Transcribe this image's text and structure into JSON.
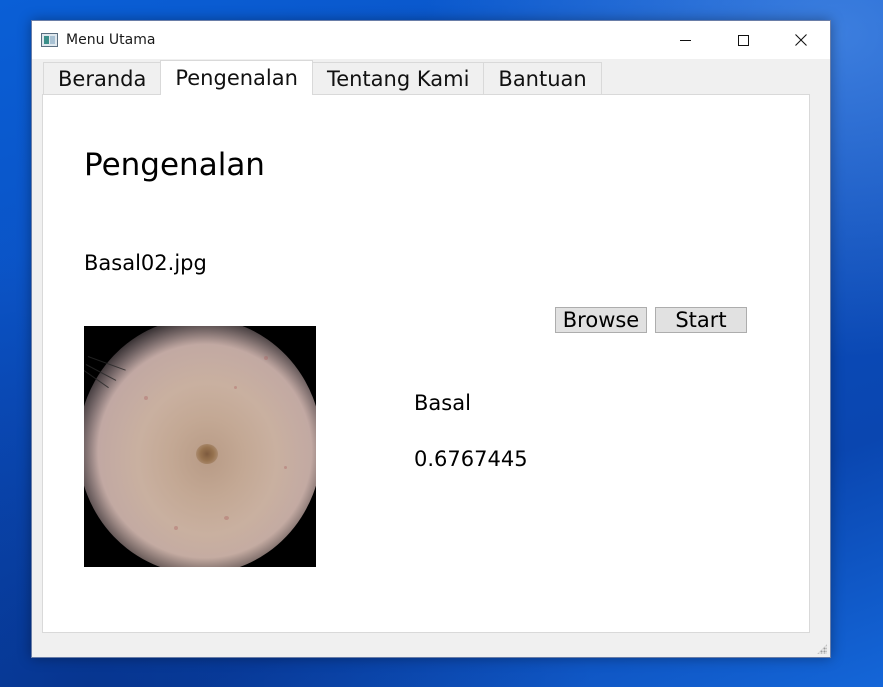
{
  "window": {
    "title": "Menu Utama",
    "icon": "app-window-icon",
    "controls": [
      "minimize-icon",
      "maximize-icon",
      "close-icon"
    ]
  },
  "tabs": [
    {
      "label": "Beranda",
      "active": false
    },
    {
      "label": "Pengenalan",
      "active": true
    },
    {
      "label": "Tentang Kami",
      "active": false
    },
    {
      "label": "Bantuan",
      "active": false
    }
  ],
  "page": {
    "title": "Pengenalan",
    "file_name": "Basal02.jpg",
    "browse_label": "Browse",
    "start_label": "Start",
    "result_class": "Basal",
    "result_score": "0.6767445"
  },
  "colors": {
    "desktop": "#0b4fc0",
    "window_bg": "#f0f0f0",
    "panel_bg": "#ffffff",
    "button_bg": "#e1e1e1"
  }
}
